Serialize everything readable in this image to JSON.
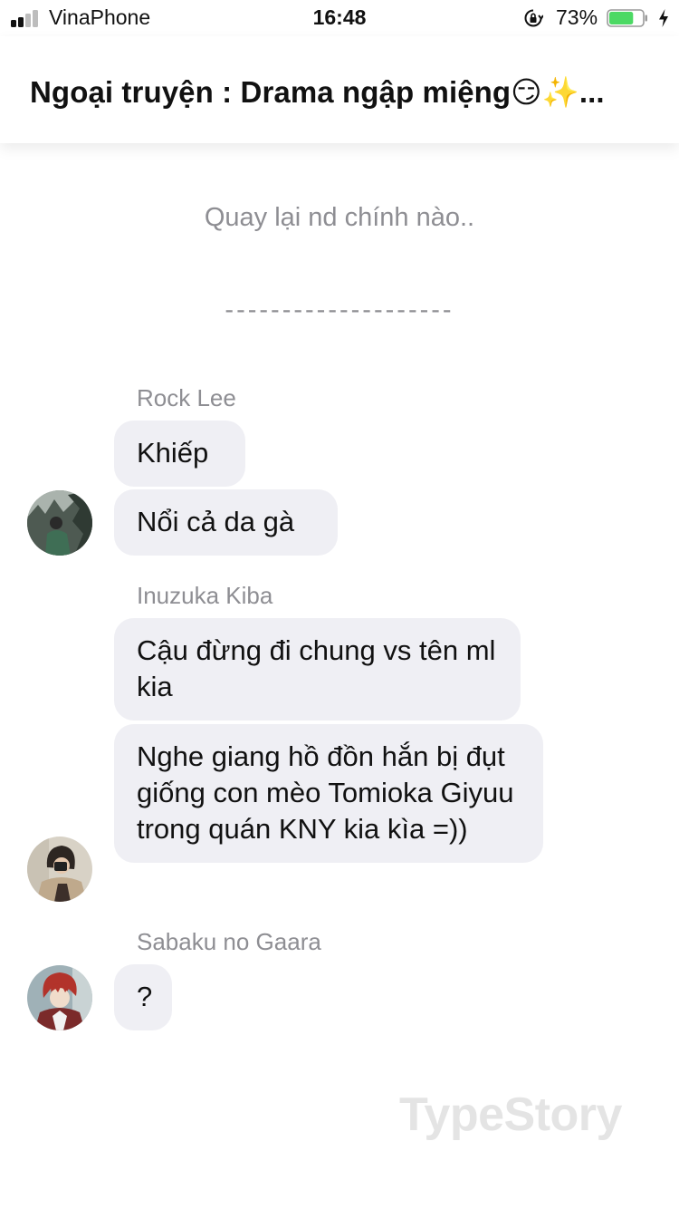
{
  "status_bar": {
    "carrier": "VinaPhone",
    "time": "16:48",
    "battery": "73%",
    "battery_level": 0.73,
    "icons": [
      "signal-icon",
      "orientation-lock-icon",
      "battery-icon",
      "charging-bolt-icon"
    ]
  },
  "header": {
    "title": "Ngoại truyện : Drama ngập miệng😏✨..."
  },
  "narration": [
    "Quay lại nd chính nào..",
    "--------------------"
  ],
  "messages": [
    {
      "sender": "Rock Lee",
      "avatar": "rock-lee-avatar",
      "bubbles": [
        "Khiếp",
        "Nổi cả da gà"
      ]
    },
    {
      "sender": "Inuzuka Kiba",
      "avatar": "inuzuka-kiba-avatar",
      "bubbles": [
        "Cậu đừng đi chung vs tên ml kia",
        "Nghe giang hồ đồn hắn bị đụt giống con mèo Tomioka Giyuu trong quán KNY kia kìa =))"
      ]
    },
    {
      "sender": "Sabaku no Gaara",
      "avatar": "sabaku-no-gaara-avatar",
      "bubbles": [
        "?"
      ]
    }
  ],
  "watermark": "TypeStory",
  "colors": {
    "bubble": "#efeff4",
    "meta_text": "#8e8e93",
    "battery_fill": "#4cd964"
  }
}
